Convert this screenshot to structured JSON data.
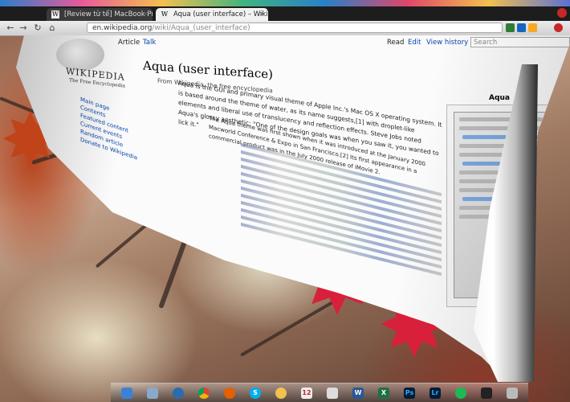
{
  "browser": {
    "tabs": [
      {
        "label": "[Review từ tế] MacBook Pro",
        "favicon": "W"
      },
      {
        "label": "Aqua (user interface) – Wiki",
        "favicon": "W"
      }
    ],
    "url_host": "en.wikipedia.org",
    "url_path": "/wiki/Aqua_(user_interface)"
  },
  "wiki": {
    "logo_text": "WIKIPEDIA",
    "logo_sub": "The Free Encyclopedia",
    "tabs": {
      "article": "Article",
      "talk": "Talk",
      "read": "Read",
      "edit": "Edit",
      "history": "View history"
    },
    "search_placeholder": "Search",
    "title": "Aqua (user interface)",
    "from": "From Wikipedia, the free encyclopedia",
    "para_lead": "Aqua is the GUI and primary visual theme of Apple Inc.'s Mac OS X operating system. It is based around the theme of water, as its name suggests,[1] with droplet-like elements and liberal use of translucency and reflection effects. Steve Jobs noted Aqua's glossy aesthetic: \"One of the design goals was when you saw it, you wanted to lick it.\"",
    "para_second": "The Aqua theme was first shown when it was introduced at the January 2000 Macworld Conference & Expo in San Francisco.[2] Its first appearance in a commercial product was in the July 2000 release of iMovie 2.",
    "nav_links": [
      "Main page",
      "Contents",
      "Featured content",
      "Current events",
      "Random article",
      "Donate to Wikipedia"
    ],
    "infobox_title": "Aqua"
  },
  "dock_icons": [
    "finder-icon",
    "mail-icon",
    "safari-icon",
    "chrome-icon",
    "firefox-icon",
    "skype-icon",
    "messages-icon",
    "calendar-icon",
    "notes-icon",
    "word-icon",
    "excel-icon",
    "photoshop-icon",
    "lightroom-icon",
    "spotify-icon",
    "terminal-icon",
    "trash-icon"
  ]
}
